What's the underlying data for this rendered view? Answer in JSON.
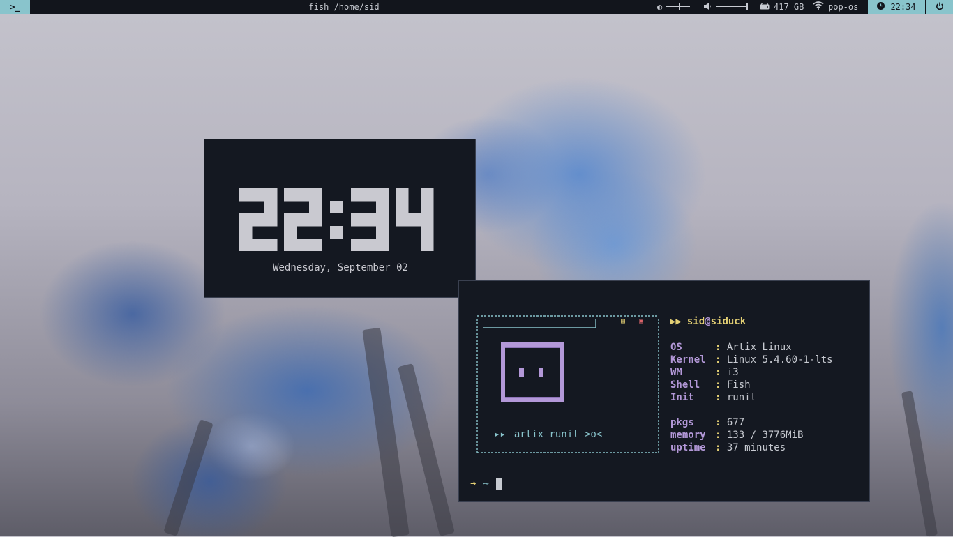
{
  "topbar": {
    "launcher_icon": ">_",
    "window_title": "fish /home/sid",
    "brightness_icon": "half-circle-icon",
    "brightness_level": 0.55,
    "volume_icon": "speaker-icon",
    "volume_level": 1.0,
    "disk_icon": "hard-drive-icon",
    "disk_free": "417 GB",
    "wifi_icon": "wifi-icon",
    "network_name": "pop-os",
    "clock_icon": "clock-icon",
    "time": "22:34",
    "power_icon": "power-icon"
  },
  "clock_widget": {
    "time": "22:34",
    "date": "Wednesday, September 02"
  },
  "terminal": {
    "ascii_caption_arrow": "▸▸",
    "ascii_caption": "artix runit >o<",
    "user": {
      "arrow": "▶▶",
      "name": "sid",
      "at": "@",
      "host": "siduck"
    },
    "info": [
      {
        "key": "OS",
        "value": "Artix Linux"
      },
      {
        "key": "Kernel",
        "value": "Linux 5.4.60-1-lts"
      },
      {
        "key": "WM",
        "value": "i3"
      },
      {
        "key": "Shell",
        "value": "Fish"
      },
      {
        "key": "Init",
        "value": "runit"
      }
    ],
    "stats": [
      {
        "key": "pkgs",
        "value": "677"
      },
      {
        "key": "memory",
        "value": "133 / 3776MiB"
      },
      {
        "key": "uptime",
        "value": "37 minutes"
      }
    ],
    "separator": ":",
    "prompt_arrow": "➜",
    "prompt_dir": "~"
  },
  "colors": {
    "accent": "#89c4cc",
    "bar_bg": "#12151c",
    "terminal_bg": "#141821",
    "purple": "#b398d8",
    "yellow": "#e3cf74",
    "red": "#d9646a"
  }
}
